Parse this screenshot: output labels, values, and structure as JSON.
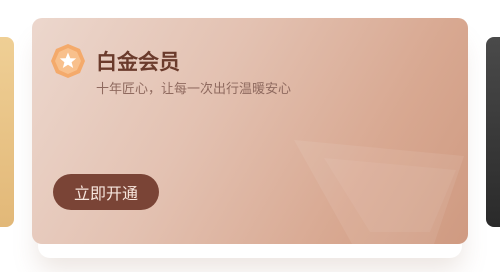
{
  "card": {
    "badge_icon": "octagon-star-badge-icon",
    "title": "白金会员",
    "subtitle": "十年匠心，让每一次出行温暖安心",
    "action_label": "立即开通"
  },
  "colors": {
    "accent": "#7a4436",
    "title": "#6b3b2c",
    "card_start": "#ecd7cd",
    "card_end": "#cf9a81",
    "badge": "#f2a163",
    "left_card": "#e8c27e",
    "right_card": "#333333"
  }
}
